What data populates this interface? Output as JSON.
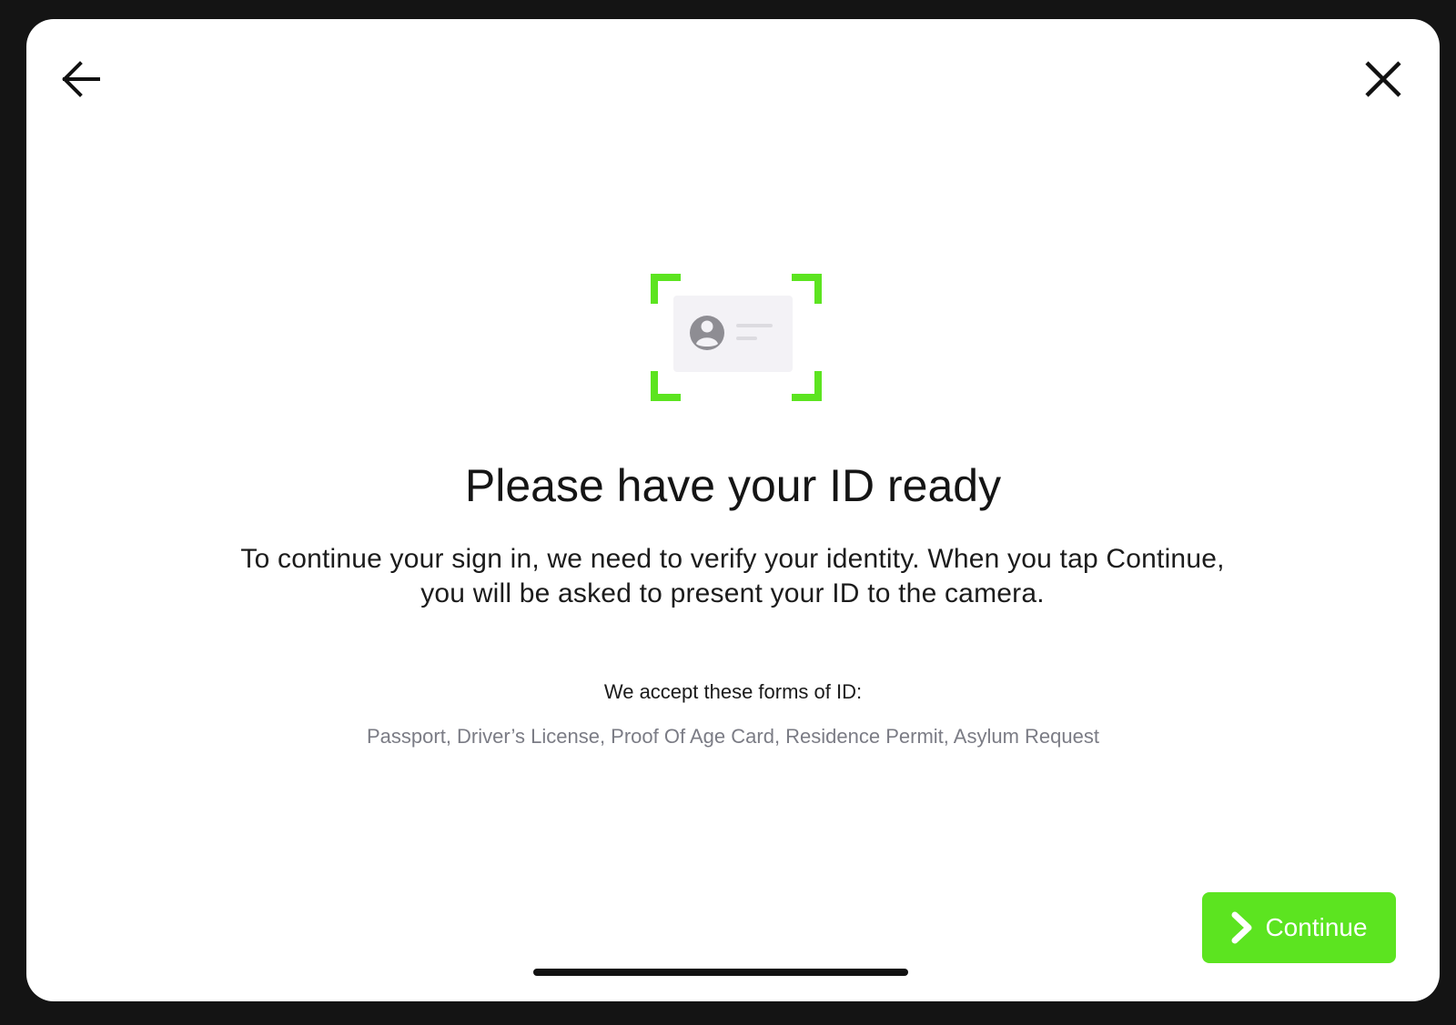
{
  "header": {
    "back_icon": "arrow-left-icon",
    "close_icon": "close-icon"
  },
  "illustration": {
    "icon": "id-card-scan-icon",
    "frame_color": "#5ce420",
    "card_color": "#f3f2f6",
    "avatar_color": "#8e8d93"
  },
  "main": {
    "title": "Please have your ID ready",
    "description": "To continue your sign in, we need to verify your identity. When you tap Continue, you will be asked to present your ID to the camera.",
    "accepted_heading": "We accept these forms of ID:",
    "accepted_list": "Passport, Driver’s License, Proof Of Age Card, Residence Permit, Asylum Request"
  },
  "footer": {
    "continue_label": "Continue",
    "continue_icon": "chevron-right-icon",
    "accent_color": "#5ce420"
  }
}
